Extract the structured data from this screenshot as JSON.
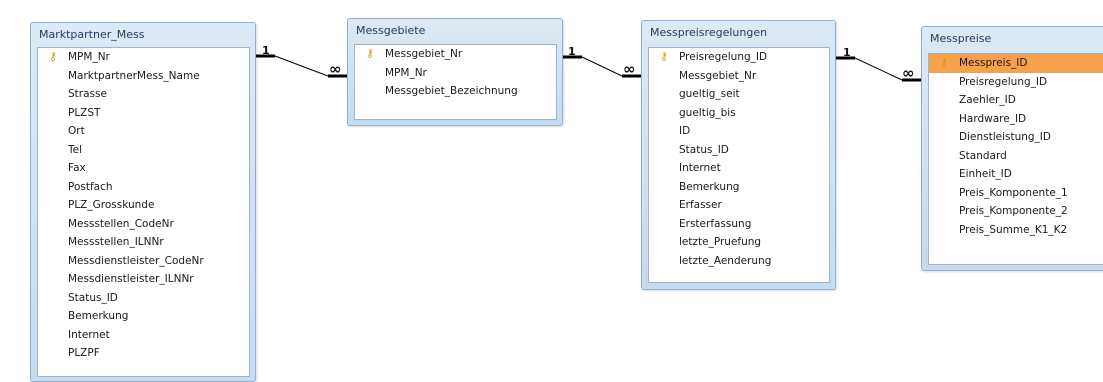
{
  "tables": [
    {
      "id": "marktpartner",
      "title": "Marktpartner_Mess",
      "fields": [
        {
          "name": "MPM_Nr",
          "key": true
        },
        {
          "name": "MarktpartnerMess_Name"
        },
        {
          "name": "Strasse"
        },
        {
          "name": "PLZST"
        },
        {
          "name": "Ort"
        },
        {
          "name": "Tel"
        },
        {
          "name": "Fax"
        },
        {
          "name": "Postfach"
        },
        {
          "name": "PLZ_Grosskunde"
        },
        {
          "name": "Messstellen_CodeNr"
        },
        {
          "name": "Messstellen_ILNNr"
        },
        {
          "name": "Messdienstleister_CodeNr"
        },
        {
          "name": "Messdienstleister_ILNNr"
        },
        {
          "name": "Status_ID"
        },
        {
          "name": "Bemerkung"
        },
        {
          "name": "Internet"
        },
        {
          "name": "PLZPF"
        }
      ]
    },
    {
      "id": "messgebiete",
      "title": "Messgebiete",
      "fields": [
        {
          "name": "Messgebiet_Nr",
          "key": true
        },
        {
          "name": "MPM_Nr"
        },
        {
          "name": "Messgebiet_Bezeichnung"
        }
      ]
    },
    {
      "id": "messpreisregelungen",
      "title": "Messpreisregelungen",
      "fields": [
        {
          "name": "Preisregelung_ID",
          "key": true
        },
        {
          "name": "Messgebiet_Nr"
        },
        {
          "name": "gueltig_seit"
        },
        {
          "name": "gueltig_bis"
        },
        {
          "name": "ID"
        },
        {
          "name": "Status_ID"
        },
        {
          "name": "Internet"
        },
        {
          "name": "Bemerkung"
        },
        {
          "name": "Erfasser"
        },
        {
          "name": "Ersterfassung"
        },
        {
          "name": "letzte_Pruefung"
        },
        {
          "name": "letzte_Aenderung"
        }
      ]
    },
    {
      "id": "messpreise",
      "title": "Messpreise",
      "fields": [
        {
          "name": "Messpreis_ID",
          "key": true,
          "selected": true
        },
        {
          "name": "Preisregelung_ID"
        },
        {
          "name": "Zaehler_ID"
        },
        {
          "name": "Hardware_ID"
        },
        {
          "name": "Dienstleistung_ID"
        },
        {
          "name": "Standard"
        },
        {
          "name": "Einheit_ID"
        },
        {
          "name": "Preis_Komponente_1"
        },
        {
          "name": "Preis_Komponente_2"
        },
        {
          "name": "Preis_Summe_K1_K2"
        }
      ]
    }
  ],
  "relationships": [
    {
      "from": "marktpartner",
      "to": "messgebiete",
      "one_label": "1",
      "many_label": "∞"
    },
    {
      "from": "messgebiete",
      "to": "messpreisregelungen",
      "one_label": "1",
      "many_label": "∞"
    },
    {
      "from": "messpreisregelungen",
      "to": "messpreise",
      "one_label": "1",
      "many_label": "∞"
    }
  ],
  "colors": {
    "selected_field": "#f7a24b",
    "header": "#c7dbef",
    "key_icon": "#c8a000"
  },
  "icons": {
    "primary_key": "key-icon"
  }
}
